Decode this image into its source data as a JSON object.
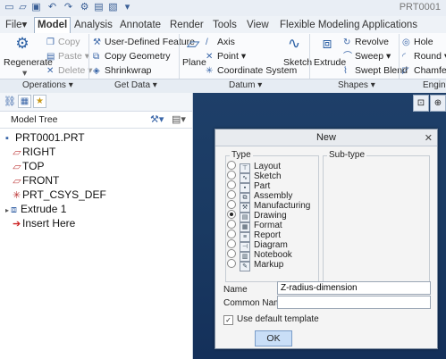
{
  "app": {
    "title": "PRT0001"
  },
  "quick_access": {
    "icons": [
      "new-file-icon",
      "open-file-icon",
      "save-icon",
      "undo-icon",
      "redo-icon",
      "regenerate-small-icon",
      "window-icon",
      "close-window-icon",
      "customize-icon"
    ]
  },
  "tabs": [
    {
      "label": "File▾"
    },
    {
      "label": "Model"
    },
    {
      "label": "Analysis"
    },
    {
      "label": "Annotate"
    },
    {
      "label": "Render"
    },
    {
      "label": "Tools"
    },
    {
      "label": "View"
    },
    {
      "label": "Flexible Modeling"
    },
    {
      "label": "Applications"
    }
  ],
  "ribbon": {
    "regenerate": "Regenerate",
    "copy": "Copy",
    "paste": "Paste",
    "delete": "Delete",
    "user_defined_feature": "User-Defined Feature",
    "copy_geometry": "Copy Geometry",
    "shrinkwrap": "Shrinkwrap",
    "plane": "Plane",
    "axis": "Axis",
    "point": "Point",
    "coordinate_system": "Coordinate System",
    "sketch": "Sketch",
    "extrude": "Extrude",
    "revolve": "Revolve",
    "sweep": "Sweep",
    "swept_blend": "Swept Blend",
    "hole": "Hole",
    "round": "Round",
    "chamfer": "Chamfer"
  },
  "groups": {
    "operations": "Operations ▾",
    "get_data": "Get Data ▾",
    "datum": "Datum ▾",
    "shapes": "Shapes ▾",
    "engineering": "Engine"
  },
  "model_tree": {
    "header": "Model Tree",
    "items": [
      {
        "label": "PRT0001.PRT"
      },
      {
        "label": "RIGHT"
      },
      {
        "label": "TOP"
      },
      {
        "label": "FRONT"
      },
      {
        "label": "PRT_CSYS_DEF"
      },
      {
        "label": "Extrude 1"
      },
      {
        "label": "Insert Here"
      }
    ]
  },
  "dialog": {
    "title": "New",
    "type_label": "Type",
    "subtype_label": "Sub-type",
    "types": [
      {
        "label": "Layout"
      },
      {
        "label": "Sketch"
      },
      {
        "label": "Part"
      },
      {
        "label": "Assembly"
      },
      {
        "label": "Manufacturing"
      },
      {
        "label": "Drawing"
      },
      {
        "label": "Format"
      },
      {
        "label": "Report"
      },
      {
        "label": "Diagram"
      },
      {
        "label": "Notebook"
      },
      {
        "label": "Markup"
      }
    ],
    "selected_type": "Drawing",
    "name_label": "Name",
    "name_value": "Z-radius-dimension",
    "common_name_label": "Common Name",
    "common_name_value": "",
    "use_default_template": "Use default template",
    "use_default_template_checked": true,
    "ok": "OK"
  }
}
